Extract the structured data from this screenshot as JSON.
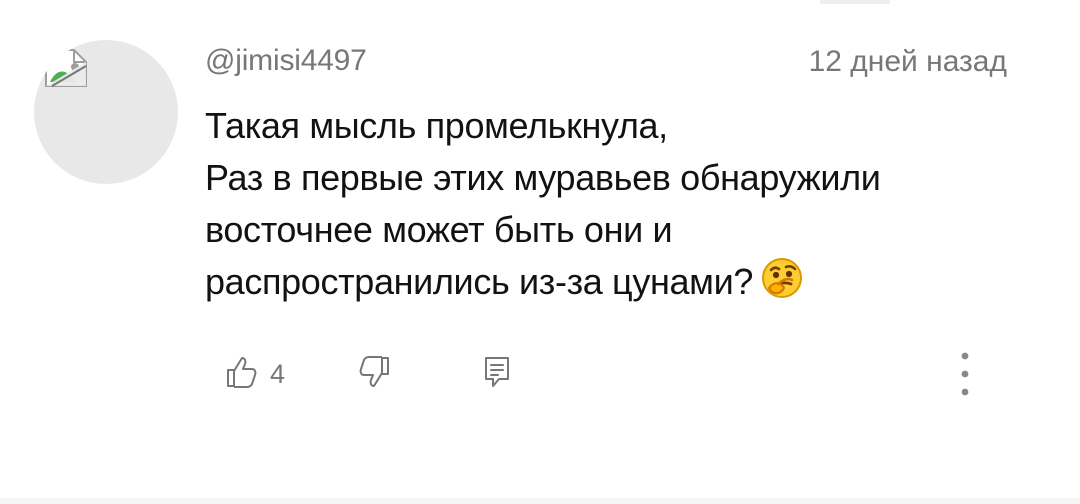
{
  "comment": {
    "username": "@jimisi4497",
    "timestamp": "12 дней назад",
    "lines": [
      "Такая мысль промелькнула,",
      "Раз в первые этих муравьев обнаружили",
      "восточнее может быть они и",
      "распространились из-за цунами?"
    ],
    "emoji": "thinking-face-emoji",
    "avatar": {
      "state": "broken-image-placeholder",
      "background_color": "#e8e8e8"
    }
  },
  "actions": {
    "likes": "4",
    "like_icon": "thumbs-up-icon",
    "dislike_icon": "thumbs-down-icon",
    "reply_icon": "reply-comment-icon",
    "more_icon": "more-vertical-icon"
  },
  "colors": {
    "primary_text": "#121212",
    "secondary_text": "#777777",
    "background": "#ffffff"
  }
}
